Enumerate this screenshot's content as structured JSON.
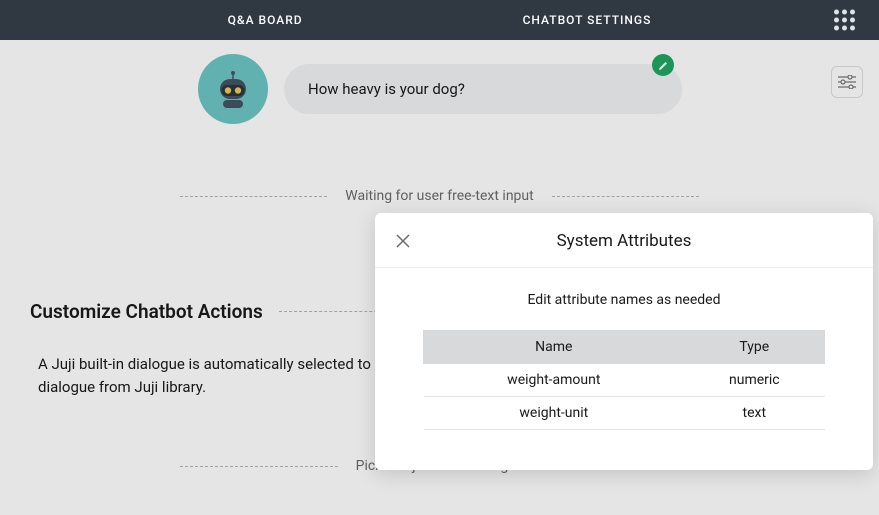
{
  "header": {
    "tabs": {
      "qa": "Q&A BOARD",
      "settings": "CHATBOT SETTINGS"
    }
  },
  "bot": {
    "message": "How heavy is your dog?"
  },
  "waiting_label": "Waiting for user free-text input",
  "customize": {
    "title": "Customize Chatbot Actions",
    "description": "A Juji built-in dialogue is automatically selected to respond to user input. You may pick a different built-in dialogue from Juji library."
  },
  "pick_label": "Pick a Juji Built-in Dialogue",
  "modal": {
    "title": "System Attributes",
    "subtitle": "Edit attribute names as needed",
    "columns": {
      "name": "Name",
      "type": "Type"
    },
    "rows": {
      "0": {
        "name": "weight-amount",
        "type": "numeric"
      },
      "1": {
        "name": "weight-unit",
        "type": "text"
      }
    }
  }
}
